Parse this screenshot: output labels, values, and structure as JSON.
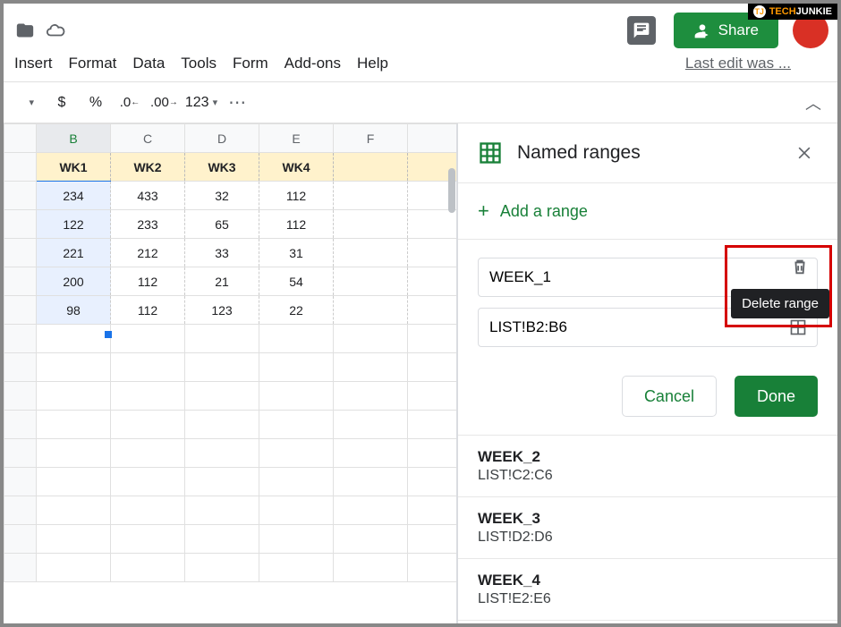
{
  "logo": {
    "prefix": "TJ",
    "tech": "TECH",
    "junkie": "JUNKIE"
  },
  "menus": {
    "insert": "Insert",
    "format": "Format",
    "data": "Data",
    "tools": "Tools",
    "form": "Form",
    "addons": "Add-ons",
    "help": "Help"
  },
  "last_edit": "Last edit was ...",
  "share_label": "Share",
  "toolbar": {
    "currency": "$",
    "percent": "%",
    "dec_dec": ".0",
    "dec_inc": ".00",
    "format123": "123",
    "more": "⋯"
  },
  "sheet": {
    "col_headers": [
      "B",
      "C",
      "D",
      "E",
      "F"
    ],
    "selected_col": "B",
    "header_row": [
      "WK1",
      "WK2",
      "WK3",
      "WK4",
      ""
    ],
    "rows": [
      [
        "234",
        "433",
        "32",
        "112",
        ""
      ],
      [
        "122",
        "233",
        "65",
        "112",
        ""
      ],
      [
        "221",
        "212",
        "33",
        "31",
        ""
      ],
      [
        "200",
        "112",
        "21",
        "54",
        ""
      ],
      [
        "98",
        "112",
        "123",
        "22",
        ""
      ]
    ]
  },
  "panel": {
    "title": "Named ranges",
    "add_label": "Add a range",
    "edit": {
      "name_value": "WEEK_1",
      "range_value": "LIST!B2:B6",
      "delete_tooltip": "Delete range"
    },
    "cancel_label": "Cancel",
    "done_label": "Done",
    "ranges": [
      {
        "name": "WEEK_2",
        "ref": "LIST!C2:C6"
      },
      {
        "name": "WEEK_3",
        "ref": "LIST!D2:D6"
      },
      {
        "name": "WEEK_4",
        "ref": "LIST!E2:E6"
      }
    ]
  }
}
